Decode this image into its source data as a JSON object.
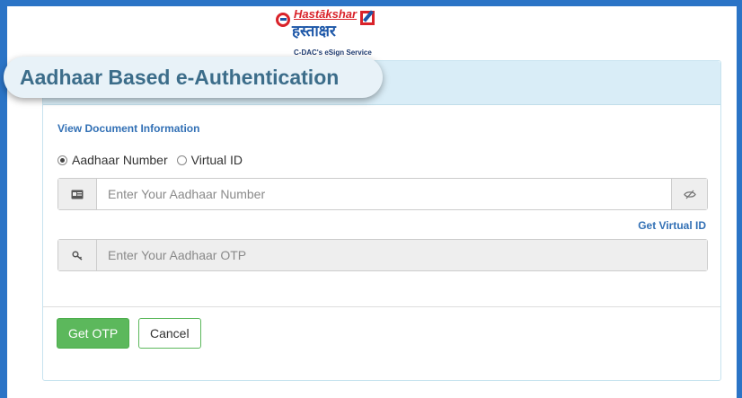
{
  "logo": {
    "brand_en": "Hastākshar",
    "brand_hi": "हस्ताक्षर",
    "tagline": "C-DAC's eSign Service"
  },
  "panel": {
    "title": "Aadhaar Based e-Authentication",
    "view_document_link": "View Document Information",
    "id_options": [
      {
        "label": "Aadhaar Number",
        "selected": true
      },
      {
        "label": "Virtual ID",
        "selected": false
      }
    ],
    "aadhaar_input": {
      "placeholder": "Enter Your Aadhaar Number",
      "value": ""
    },
    "get_virtual_id_link": "Get Virtual ID",
    "otp_input": {
      "placeholder": "Enter Your Aadhaar OTP",
      "value": "",
      "disabled": true
    },
    "get_otp_button": "Get OTP",
    "cancel_button": "Cancel"
  },
  "colors": {
    "frame_border": "#2b74c6",
    "panel_heading_bg": "#d9edf7",
    "link": "#3270b5",
    "success": "#5cb85c"
  },
  "icons": [
    "id-card-icon",
    "key-icon",
    "eye-slash-icon"
  ]
}
